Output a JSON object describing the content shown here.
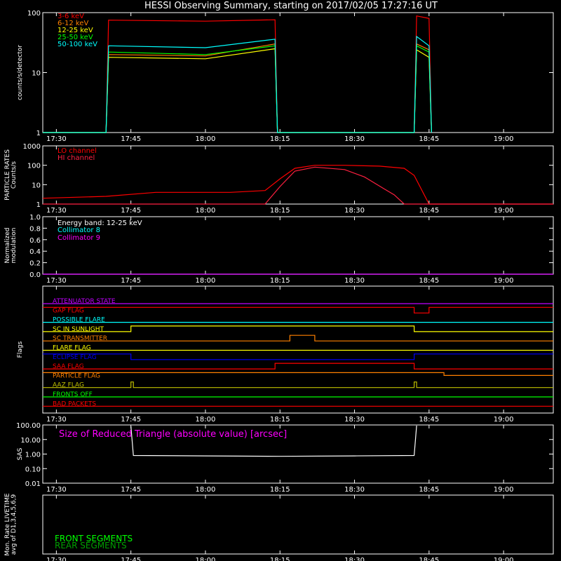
{
  "title": "HESSI Observing Summary, starting on 2017/02/05 17:27:16 UT",
  "x_ticks": [
    "17:30",
    "17:45",
    "18:00",
    "18:15",
    "18:30",
    "18:45",
    "19:00"
  ],
  "colors": {
    "frame": "#ffffff",
    "red": "#ff0000",
    "orange": "#ff8000",
    "yellow": "#ffff00",
    "green": "#00ff00",
    "cyan": "#00ffff",
    "magenta": "#ff00ff",
    "blue": "#0000ff",
    "olive": "#c0c000",
    "darkgreen": "#00a000",
    "purple": "#c000ff",
    "crimson": "#ff2040"
  },
  "chart_data": [
    {
      "id": "counts",
      "type": "line",
      "ylabel": "counts/s/detector",
      "yscale": "log",
      "ylim": [
        1,
        100
      ],
      "y_ticks": [
        "1",
        "10",
        "100"
      ],
      "series": [
        {
          "name": "3-6 keV",
          "color": "red",
          "x": [
            "17:27:16",
            "17:40",
            "17:40:30",
            "18:00",
            "18:14",
            "18:14:30",
            "18:42:00",
            "18:42:30",
            "18:45",
            "18:45:30"
          ],
          "y": [
            1,
            1,
            75,
            72,
            76,
            1,
            1,
            88,
            80,
            1
          ]
        },
        {
          "name": "6-12 keV",
          "color": "orange",
          "x": [
            "17:27:16",
            "17:40",
            "17:40:30",
            "18:00",
            "18:14",
            "18:14:30",
            "18:42:00",
            "18:42:30",
            "18:45",
            "18:45:30"
          ],
          "y": [
            1,
            1,
            20,
            19,
            30,
            1,
            1,
            30,
            24,
            1
          ]
        },
        {
          "name": "12-25 keV",
          "color": "yellow",
          "x": [
            "17:27:16",
            "17:40",
            "17:40:30",
            "18:00",
            "18:14",
            "18:14:30",
            "18:42:00",
            "18:42:30",
            "18:45",
            "18:45:30"
          ],
          "y": [
            1,
            1,
            18,
            17,
            25,
            1,
            1,
            24,
            18,
            1
          ]
        },
        {
          "name": "25-50 keV",
          "color": "green",
          "x": [
            "17:27:16",
            "17:40",
            "17:40:30",
            "18:00",
            "18:14",
            "18:14:30",
            "18:42:00",
            "18:42:30",
            "18:45",
            "18:45:30"
          ],
          "y": [
            1,
            1,
            22,
            20,
            28,
            1,
            1,
            28,
            22,
            1
          ]
        },
        {
          "name": "50-100 keV",
          "color": "cyan",
          "x": [
            "17:27:16",
            "17:40",
            "17:40:30",
            "18:00",
            "18:14",
            "18:14:30",
            "18:42:00",
            "18:42:30",
            "18:45",
            "18:45:30"
          ],
          "y": [
            1,
            1,
            28,
            26,
            36,
            1,
            1,
            40,
            28,
            1
          ]
        }
      ]
    },
    {
      "id": "particle",
      "type": "line",
      "ylabel": "PARTICLE RATES\nCounts/s",
      "yscale": "log",
      "ylim": [
        1,
        1000
      ],
      "y_ticks": [
        "1",
        "10",
        "100",
        "1000"
      ],
      "series": [
        {
          "name": "LO channel",
          "color": "red",
          "x": [
            "17:27:16",
            "17:40",
            "17:50",
            "18:05",
            "18:12",
            "18:15",
            "18:18",
            "18:22",
            "18:28",
            "18:35",
            "18:40",
            "18:42",
            "18:45",
            "18:50",
            "19:10"
          ],
          "y": [
            2,
            2.5,
            4,
            4,
            5,
            20,
            70,
            100,
            100,
            90,
            70,
            30,
            1,
            1,
            1
          ]
        },
        {
          "name": "HI channel",
          "color": "crimson",
          "x": [
            "17:27:16",
            "18:12",
            "18:15",
            "18:18",
            "18:22",
            "18:28",
            "18:32",
            "18:36",
            "18:38",
            "18:40",
            "19:10"
          ],
          "y": [
            1,
            1,
            8,
            50,
            80,
            60,
            25,
            6,
            3,
            1,
            1
          ]
        }
      ]
    },
    {
      "id": "modulation",
      "type": "line",
      "ylabel": "Normalized\nmodulation",
      "ylim": [
        0,
        1
      ],
      "y_ticks": [
        "0.0",
        "0.2",
        "0.4",
        "0.6",
        "0.8",
        "1.0"
      ],
      "annotation": "Energy band: 12-25 keV",
      "series": [
        {
          "name": "Collimator 8",
          "color": "cyan",
          "x": [
            "17:27:16",
            "19:10"
          ],
          "y": [
            0,
            0
          ]
        },
        {
          "name": "Collimator 9",
          "color": "magenta",
          "x": [
            "17:27:16",
            "19:10"
          ],
          "y": [
            0,
            0
          ]
        }
      ]
    },
    {
      "id": "flags",
      "type": "line",
      "ylabel": "Flags",
      "series": [
        {
          "name": "ATTENUATOR STATE",
          "color": "purple",
          "x": [
            "17:27:16",
            "19:10"
          ],
          "y": [
            0,
            0
          ]
        },
        {
          "name": "GAP FLAG",
          "color": "red",
          "x": [
            "17:27:16",
            "18:42",
            "18:42",
            "18:45",
            "18:45",
            "19:10"
          ],
          "y": [
            1,
            1,
            0,
            0,
            1,
            1
          ]
        },
        {
          "name": "POSSIBLE FLARE",
          "color": "cyan",
          "x": [
            "17:27:16",
            "19:10"
          ],
          "y": [
            0,
            0
          ]
        },
        {
          "name": "SC IN SUNLIGHT",
          "color": "yellow",
          "x": [
            "17:27:16",
            "17:45",
            "17:45",
            "18:42",
            "18:42",
            "19:10"
          ],
          "y": [
            0,
            0,
            1,
            1,
            0,
            0
          ]
        },
        {
          "name": "SC TRANSMITTER",
          "color": "orange",
          "x": [
            "17:27:16",
            "18:17",
            "18:17",
            "18:22",
            "18:22",
            "19:10"
          ],
          "y": [
            0,
            0,
            1,
            1,
            0,
            0
          ]
        },
        {
          "name": "FLARE FLAG",
          "color": "yellow",
          "x": [
            "17:27:16",
            "19:10"
          ],
          "y": [
            0,
            0
          ]
        },
        {
          "name": "ECLIPSE FLAG",
          "color": "blue",
          "x": [
            "17:27:16",
            "17:45",
            "17:45",
            "18:42",
            "18:42",
            "19:10"
          ],
          "y": [
            1,
            1,
            0,
            0,
            1,
            1
          ]
        },
        {
          "name": "SAA FLAG",
          "color": "red",
          "x": [
            "17:27:16",
            "18:14",
            "18:14",
            "18:42",
            "18:42",
            "19:10"
          ],
          "y": [
            0,
            0,
            1,
            1,
            0,
            0
          ]
        },
        {
          "name": "PARTICLE FLAG",
          "color": "orange",
          "x": [
            "17:27:16",
            "18:48",
            "18:48",
            "19:10"
          ],
          "y": [
            1,
            1,
            0.5,
            0.5
          ]
        },
        {
          "name": "AAZ FLAG",
          "color": "olive",
          "x": [
            "17:27:16",
            "17:45",
            "17:45",
            "17:45:30",
            "17:45:30",
            "18:42",
            "18:42",
            "18:42:30",
            "18:42:30",
            "19:10"
          ],
          "y": [
            0,
            0,
            1,
            1,
            0,
            0,
            1,
            1,
            0,
            0
          ]
        },
        {
          "name": "FRONTS OFF",
          "color": "green",
          "x": [
            "17:27:16",
            "19:10"
          ],
          "y": [
            0,
            0
          ]
        },
        {
          "name": "BAD PACKETS",
          "color": "red",
          "x": [
            "17:27:16",
            "19:10"
          ],
          "y": [
            0,
            0
          ]
        }
      ]
    },
    {
      "id": "sas",
      "type": "line",
      "ylabel": "SAS",
      "yscale": "log",
      "ylim": [
        0.01,
        100
      ],
      "y_ticks": [
        "0.01",
        "0.10",
        "1.00",
        "10.00",
        "100.00"
      ],
      "annotation": "Size of Reduced Triangle (absolute value) [arcsec]",
      "series": [
        {
          "name": "Size of Reduced Triangle",
          "color": "frame",
          "x": [
            "17:45",
            "17:45:30",
            "18:00",
            "18:15",
            "18:30",
            "18:42",
            "18:42:30"
          ],
          "y": [
            80,
            0.8,
            0.75,
            0.7,
            0.75,
            0.8,
            90
          ]
        }
      ]
    },
    {
      "id": "livetime",
      "type": "line",
      "ylabel": "Mon. Rate LIVETIME\navg of D1,3,4,5,6,9",
      "series": [
        {
          "name": "FRONT SEGMENTS",
          "color": "green",
          "x": [],
          "y": []
        },
        {
          "name": "REAR SEGMENTS",
          "color": "darkgreen",
          "x": [],
          "y": []
        }
      ]
    }
  ]
}
